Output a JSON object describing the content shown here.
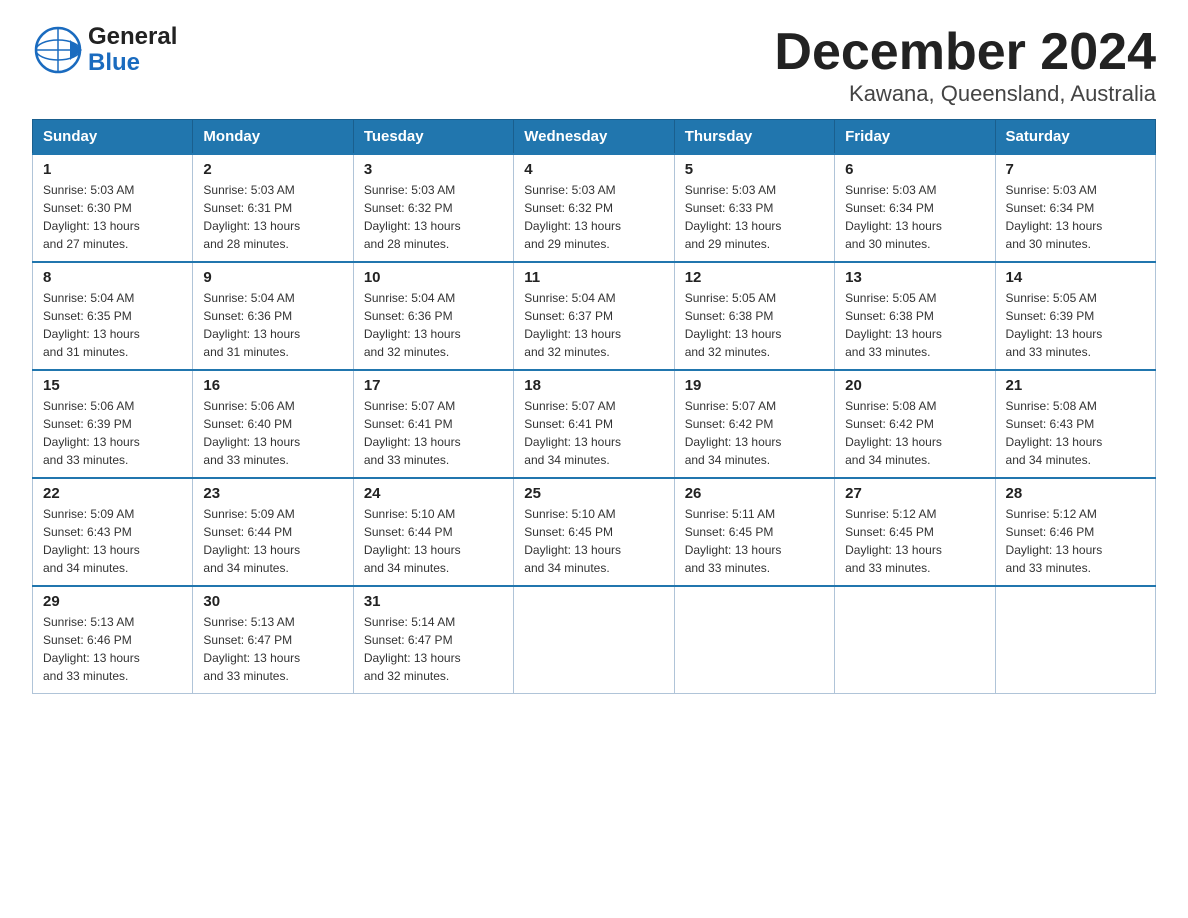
{
  "header": {
    "logo_general": "General",
    "logo_blue": "Blue",
    "title": "December 2024",
    "subtitle": "Kawana, Queensland, Australia"
  },
  "calendar": {
    "days_of_week": [
      "Sunday",
      "Monday",
      "Tuesday",
      "Wednesday",
      "Thursday",
      "Friday",
      "Saturday"
    ],
    "weeks": [
      [
        {
          "day": "1",
          "sunrise": "5:03 AM",
          "sunset": "6:30 PM",
          "daylight": "13 hours and 27 minutes."
        },
        {
          "day": "2",
          "sunrise": "5:03 AM",
          "sunset": "6:31 PM",
          "daylight": "13 hours and 28 minutes."
        },
        {
          "day": "3",
          "sunrise": "5:03 AM",
          "sunset": "6:32 PM",
          "daylight": "13 hours and 28 minutes."
        },
        {
          "day": "4",
          "sunrise": "5:03 AM",
          "sunset": "6:32 PM",
          "daylight": "13 hours and 29 minutes."
        },
        {
          "day": "5",
          "sunrise": "5:03 AM",
          "sunset": "6:33 PM",
          "daylight": "13 hours and 29 minutes."
        },
        {
          "day": "6",
          "sunrise": "5:03 AM",
          "sunset": "6:34 PM",
          "daylight": "13 hours and 30 minutes."
        },
        {
          "day": "7",
          "sunrise": "5:03 AM",
          "sunset": "6:34 PM",
          "daylight": "13 hours and 30 minutes."
        }
      ],
      [
        {
          "day": "8",
          "sunrise": "5:04 AM",
          "sunset": "6:35 PM",
          "daylight": "13 hours and 31 minutes."
        },
        {
          "day": "9",
          "sunrise": "5:04 AM",
          "sunset": "6:36 PM",
          "daylight": "13 hours and 31 minutes."
        },
        {
          "day": "10",
          "sunrise": "5:04 AM",
          "sunset": "6:36 PM",
          "daylight": "13 hours and 32 minutes."
        },
        {
          "day": "11",
          "sunrise": "5:04 AM",
          "sunset": "6:37 PM",
          "daylight": "13 hours and 32 minutes."
        },
        {
          "day": "12",
          "sunrise": "5:05 AM",
          "sunset": "6:38 PM",
          "daylight": "13 hours and 32 minutes."
        },
        {
          "day": "13",
          "sunrise": "5:05 AM",
          "sunset": "6:38 PM",
          "daylight": "13 hours and 33 minutes."
        },
        {
          "day": "14",
          "sunrise": "5:05 AM",
          "sunset": "6:39 PM",
          "daylight": "13 hours and 33 minutes."
        }
      ],
      [
        {
          "day": "15",
          "sunrise": "5:06 AM",
          "sunset": "6:39 PM",
          "daylight": "13 hours and 33 minutes."
        },
        {
          "day": "16",
          "sunrise": "5:06 AM",
          "sunset": "6:40 PM",
          "daylight": "13 hours and 33 minutes."
        },
        {
          "day": "17",
          "sunrise": "5:07 AM",
          "sunset": "6:41 PM",
          "daylight": "13 hours and 33 minutes."
        },
        {
          "day": "18",
          "sunrise": "5:07 AM",
          "sunset": "6:41 PM",
          "daylight": "13 hours and 34 minutes."
        },
        {
          "day": "19",
          "sunrise": "5:07 AM",
          "sunset": "6:42 PM",
          "daylight": "13 hours and 34 minutes."
        },
        {
          "day": "20",
          "sunrise": "5:08 AM",
          "sunset": "6:42 PM",
          "daylight": "13 hours and 34 minutes."
        },
        {
          "day": "21",
          "sunrise": "5:08 AM",
          "sunset": "6:43 PM",
          "daylight": "13 hours and 34 minutes."
        }
      ],
      [
        {
          "day": "22",
          "sunrise": "5:09 AM",
          "sunset": "6:43 PM",
          "daylight": "13 hours and 34 minutes."
        },
        {
          "day": "23",
          "sunrise": "5:09 AM",
          "sunset": "6:44 PM",
          "daylight": "13 hours and 34 minutes."
        },
        {
          "day": "24",
          "sunrise": "5:10 AM",
          "sunset": "6:44 PM",
          "daylight": "13 hours and 34 minutes."
        },
        {
          "day": "25",
          "sunrise": "5:10 AM",
          "sunset": "6:45 PM",
          "daylight": "13 hours and 34 minutes."
        },
        {
          "day": "26",
          "sunrise": "5:11 AM",
          "sunset": "6:45 PM",
          "daylight": "13 hours and 33 minutes."
        },
        {
          "day": "27",
          "sunrise": "5:12 AM",
          "sunset": "6:45 PM",
          "daylight": "13 hours and 33 minutes."
        },
        {
          "day": "28",
          "sunrise": "5:12 AM",
          "sunset": "6:46 PM",
          "daylight": "13 hours and 33 minutes."
        }
      ],
      [
        {
          "day": "29",
          "sunrise": "5:13 AM",
          "sunset": "6:46 PM",
          "daylight": "13 hours and 33 minutes."
        },
        {
          "day": "30",
          "sunrise": "5:13 AM",
          "sunset": "6:47 PM",
          "daylight": "13 hours and 33 minutes."
        },
        {
          "day": "31",
          "sunrise": "5:14 AM",
          "sunset": "6:47 PM",
          "daylight": "13 hours and 32 minutes."
        },
        null,
        null,
        null,
        null
      ]
    ],
    "sunrise_label": "Sunrise:",
    "sunset_label": "Sunset:",
    "daylight_label": "Daylight:"
  }
}
